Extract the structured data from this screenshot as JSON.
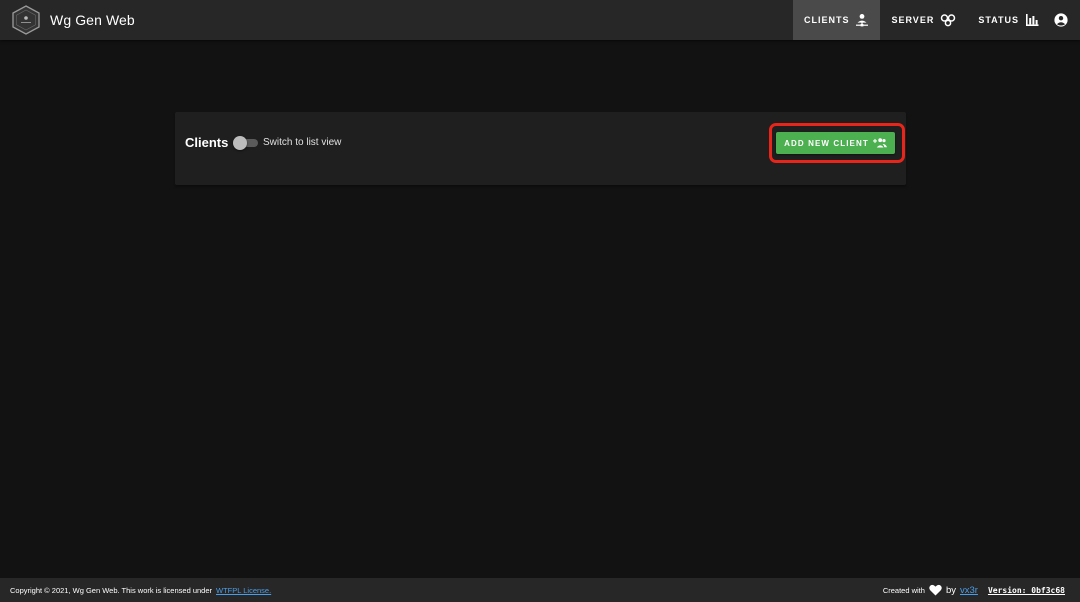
{
  "app": {
    "title": "Wg Gen Web",
    "logo_icon": "hexagon-logo-icon"
  },
  "nav": {
    "items": [
      {
        "label": "CLIENTS",
        "icon": "user-network-icon",
        "active": true
      },
      {
        "label": "SERVER",
        "icon": "vpn-knot-icon",
        "active": false
      },
      {
        "label": "STATUS",
        "icon": "bar-chart-icon",
        "active": false
      }
    ],
    "account_icon": "account-circle-icon"
  },
  "clients_card": {
    "title": "Clients",
    "switch_label": "Switch to list view",
    "switch_on": false,
    "add_button_label": "ADD NEW CLIENT",
    "add_button_icon": "account-multiple-plus-icon"
  },
  "footer": {
    "copyright": "Copyright © 2021, Wg Gen Web. This work is licensed under",
    "license_link": "WTFPL License.",
    "created_with": "Created with",
    "heart_icon": "heart-icon",
    "by": "by",
    "author": "vx3r",
    "version": "Version: 0bf3c68"
  },
  "colors": {
    "background": "#121212",
    "appbar": "#272727",
    "card": "#1f1f1f",
    "active_tab": "#4a4a4a",
    "accent_green": "#4caf50",
    "link_blue": "#4a9ee8",
    "highlight_red": "#e8251a"
  }
}
